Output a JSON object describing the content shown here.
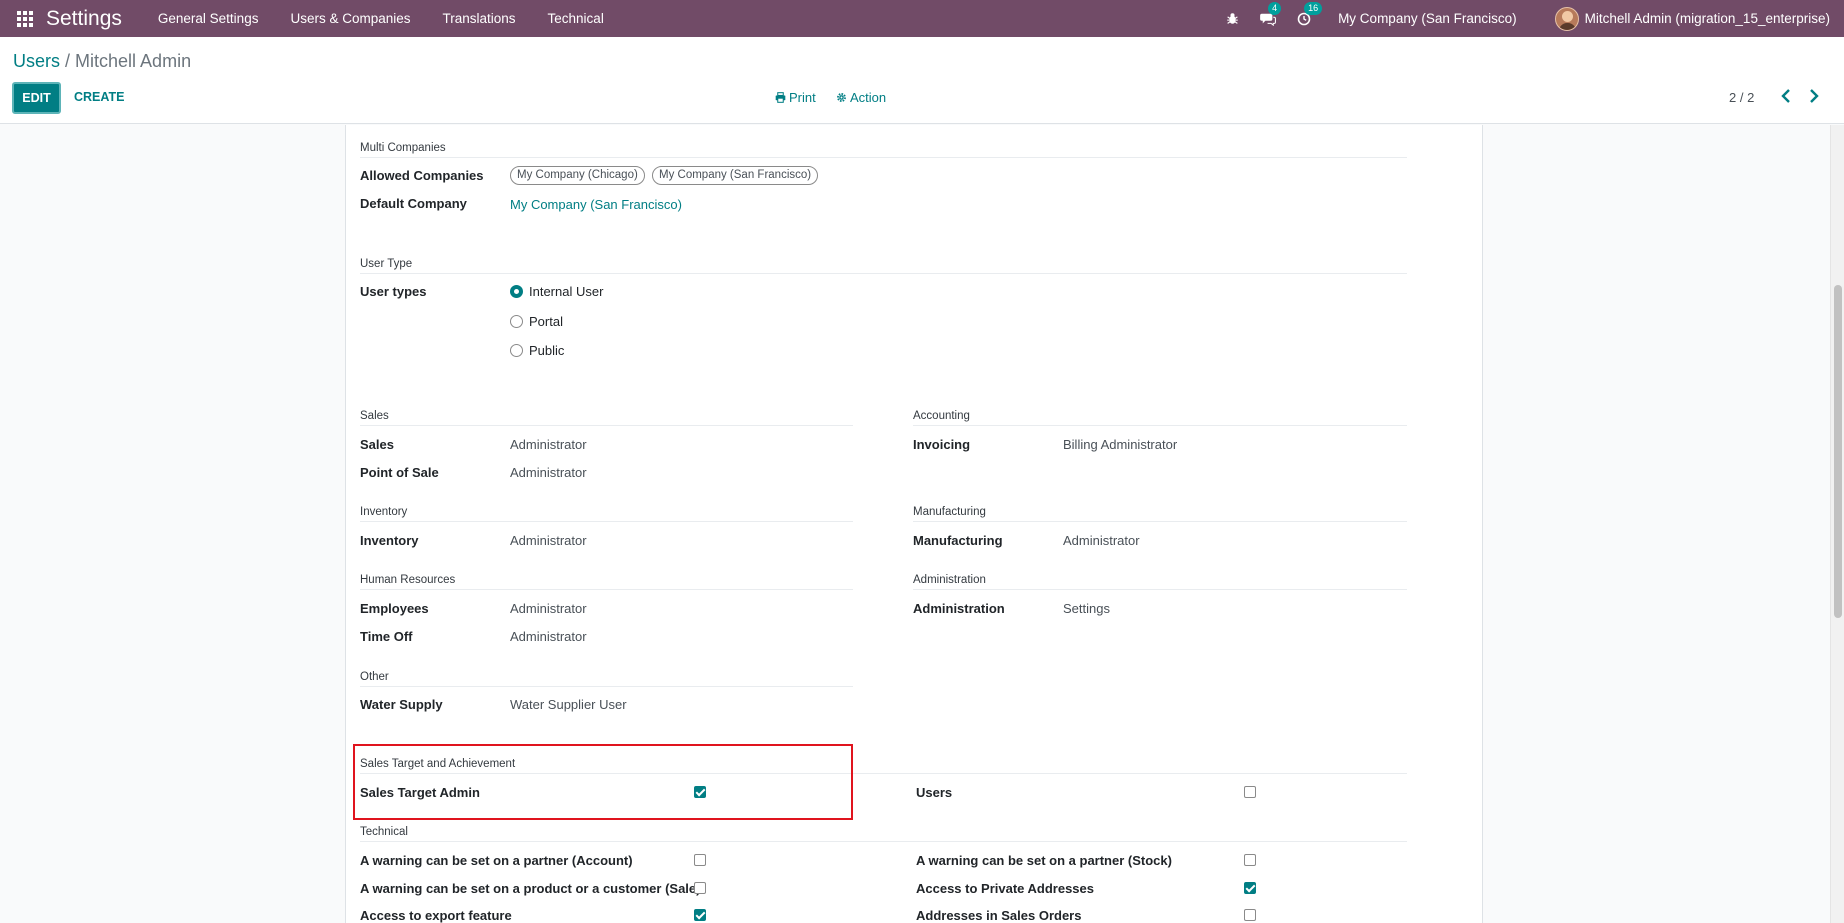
{
  "navbar": {
    "brand": "Settings",
    "menu": [
      "General Settings",
      "Users & Companies",
      "Translations",
      "Technical"
    ],
    "messages_count": "4",
    "activities_count": "16",
    "company": "My Company (San Francisco)",
    "user": "Mitchell Admin (migration_15_enterprise)"
  },
  "control_panel": {
    "breadcrumb_parent": "Users",
    "breadcrumb_sep": " / ",
    "breadcrumb_current": "Mitchell Admin",
    "edit_label": "EDIT",
    "create_label": "CREATE",
    "print_label": "Print",
    "action_label": "Action",
    "pager": "2 / 2"
  },
  "form": {
    "multi_companies": {
      "title": "Multi Companies",
      "allowed_label": "Allowed Companies",
      "allowed_tags": [
        "My Company (Chicago)",
        "My Company (San Francisco)"
      ],
      "default_label": "Default Company",
      "default_value": "My Company (San Francisco)"
    },
    "user_type": {
      "title": "User Type",
      "label": "User types",
      "options": [
        "Internal User",
        "Portal",
        "Public"
      ],
      "selected": "Internal User"
    },
    "sales": {
      "title": "Sales",
      "rows": [
        [
          "Sales",
          "Administrator"
        ],
        [
          "Point of Sale",
          "Administrator"
        ]
      ]
    },
    "accounting": {
      "title": "Accounting",
      "rows": [
        [
          "Invoicing",
          "Billing Administrator"
        ]
      ]
    },
    "inventory": {
      "title": "Inventory",
      "rows": [
        [
          "Inventory",
          "Administrator"
        ]
      ]
    },
    "manufacturing": {
      "title": "Manufacturing",
      "rows": [
        [
          "Manufacturing",
          "Administrator"
        ]
      ]
    },
    "human_resources": {
      "title": "Human Resources",
      "rows": [
        [
          "Employees",
          "Administrator"
        ],
        [
          "Time Off",
          "Administrator"
        ]
      ]
    },
    "administration": {
      "title": "Administration",
      "rows": [
        [
          "Administration",
          "Settings"
        ]
      ]
    },
    "other": {
      "title": "Other",
      "rows": [
        [
          "Water Supply",
          "Water Supplier User"
        ]
      ]
    },
    "sales_target": {
      "title": "Sales Target and Achievement",
      "items": [
        {
          "label": "Sales Target Admin",
          "checked": true
        },
        {
          "label": "Users",
          "checked": false
        }
      ]
    },
    "technical": {
      "title": "Technical",
      "items": [
        {
          "label": "A warning can be set on a partner (Account)",
          "checked": false
        },
        {
          "label": "A warning can be set on a partner (Stock)",
          "checked": false
        },
        {
          "label": "A warning can be set on a product or a customer (Sale)",
          "checked": false
        },
        {
          "label": "Access to Private Addresses",
          "checked": true
        },
        {
          "label": "Access to export feature",
          "checked": true
        },
        {
          "label": "Addresses in Sales Orders",
          "checked": false
        }
      ]
    }
  },
  "colors": {
    "navbar": "#714b67",
    "accent": "#017e84",
    "highlight": "#e0141e"
  }
}
